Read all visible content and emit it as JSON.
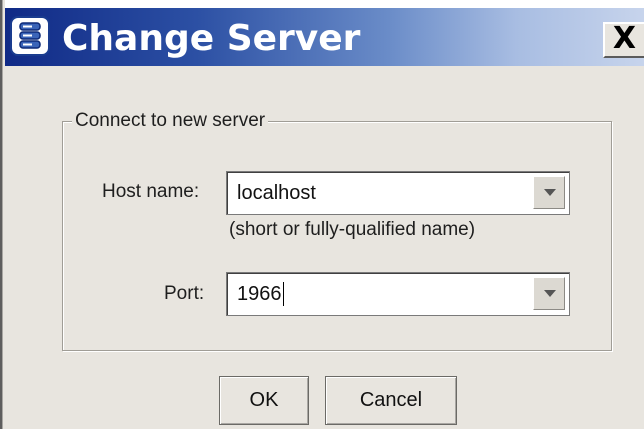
{
  "window": {
    "title": "Change Server",
    "close_label": "X"
  },
  "group": {
    "legend": "Connect to new server"
  },
  "host": {
    "label": "Host name:",
    "value": "localhost",
    "hint": "(short or fully-qualified name)"
  },
  "port": {
    "label": "Port:",
    "value": "1966"
  },
  "buttons": {
    "ok": "OK",
    "cancel": "Cancel"
  },
  "icons": {
    "app": "server-app-icon",
    "close": "close-icon",
    "dropdown": "chevron-down-icon"
  },
  "colors": {
    "titlebar_start": "#102a86",
    "titlebar_end": "#c7d4ec",
    "dialog_background": "#e8e5df"
  }
}
